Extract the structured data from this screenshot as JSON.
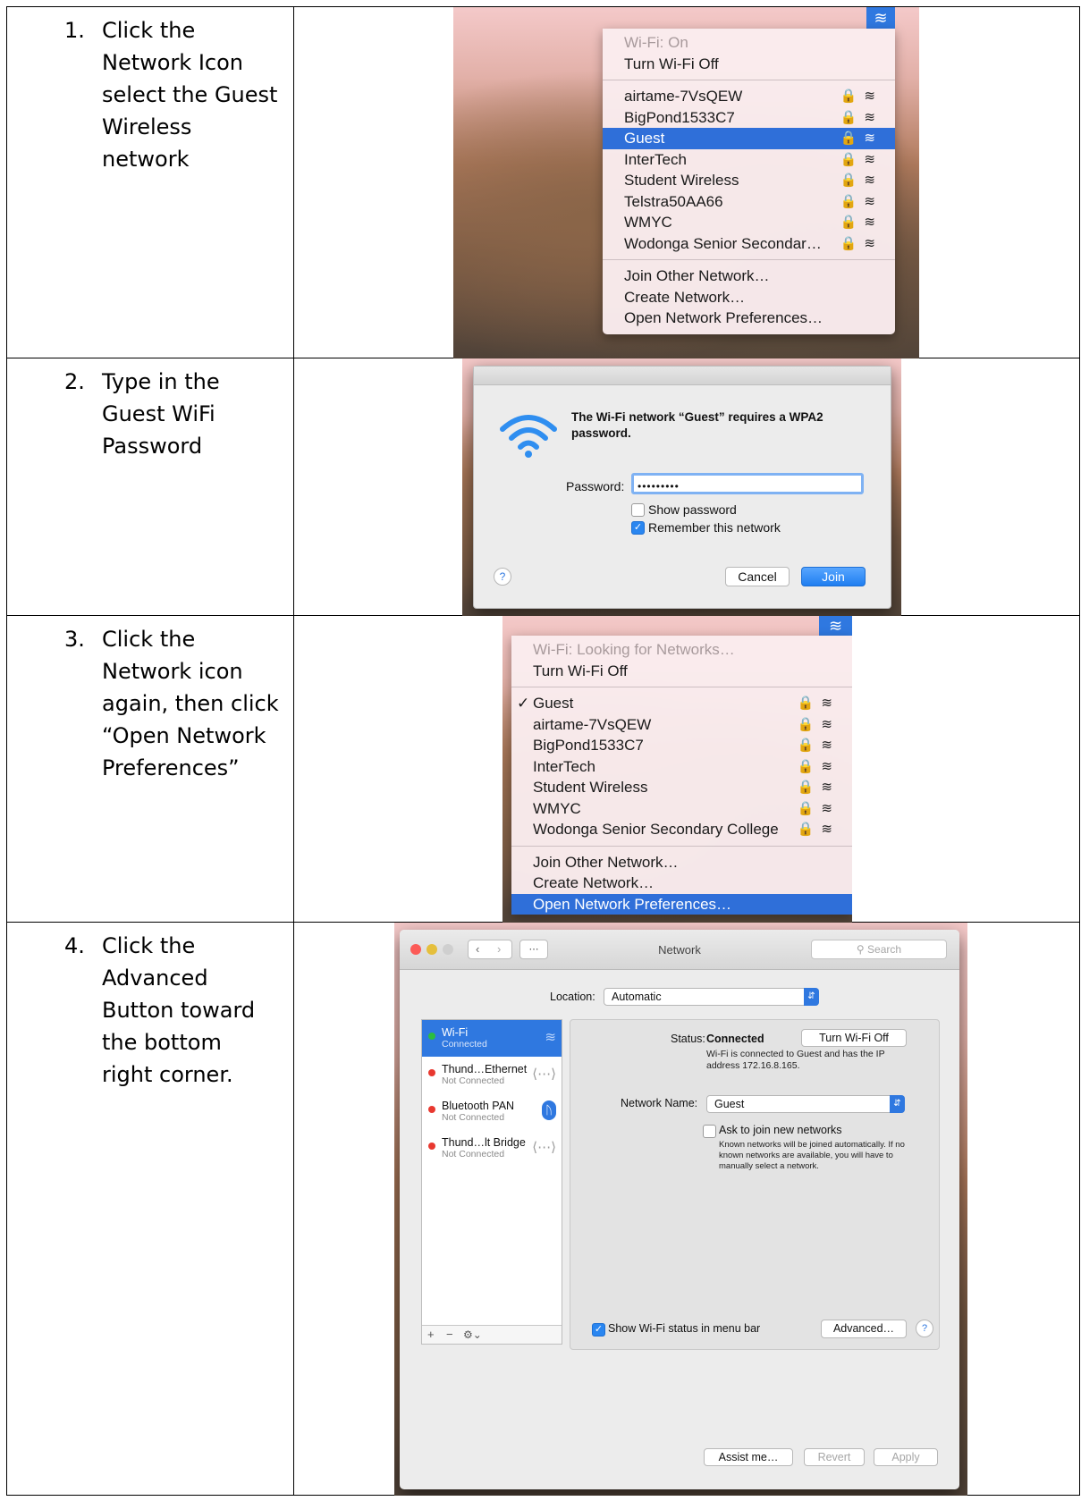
{
  "steps": [
    {
      "number": "1.",
      "lines": [
        "Click the",
        "Network Icon",
        "select the Guest",
        "Wireless",
        "network"
      ]
    },
    {
      "number": "2.",
      "lines": [
        "Type in the",
        "Guest WiFi",
        "Password"
      ]
    },
    {
      "number": "3.",
      "lines": [
        "Click the",
        "Network icon",
        "again, then click",
        "“Open Network",
        "Preferences”"
      ]
    },
    {
      "number": "4.",
      "lines": [
        "Click the",
        "Advanced",
        "Button toward",
        "the bottom",
        "right corner."
      ]
    }
  ],
  "menu1": {
    "status": "Wi-Fi: On",
    "toggle": "Turn Wi-Fi Off",
    "networks": [
      "airtame-7VsQEW",
      "BigPond1533C7",
      "Guest",
      "InterTech",
      "Student Wireless",
      "Telstra50AA66",
      "WMYC",
      "Wodonga Senior Secondar…"
    ],
    "selected_network": "Guest",
    "actions": [
      "Join Other Network…",
      "Create Network…",
      "Open Network Preferences…"
    ]
  },
  "dialog": {
    "message": "The Wi-Fi network “Guest” requires a WPA2 password.",
    "password_label": "Password:",
    "password_value": "•••••••••",
    "show_password": "Show password",
    "remember": "Remember this network",
    "help": "?",
    "cancel": "Cancel",
    "join": "Join"
  },
  "menu3": {
    "status": "Wi-Fi: Looking for Networks…",
    "toggle": "Turn Wi-Fi Off",
    "connected_mark": "✓",
    "networks": [
      "Guest",
      "airtame-7VsQEW",
      "BigPond1533C7",
      "InterTech",
      "Student Wireless",
      "WMYC",
      "Wodonga Senior Secondary College"
    ],
    "actions": [
      "Join Other Network…",
      "Create Network…",
      "Open Network Preferences…"
    ],
    "highlighted_action": "Open Network Preferences…"
  },
  "netprefs": {
    "title": "Network",
    "search_placeholder": "Search",
    "location_label": "Location:",
    "location_value": "Automatic",
    "services": [
      {
        "name": "Wi-Fi",
        "status": "Connected",
        "color": "#2bbd3f"
      },
      {
        "name": "Thund…Ethernet",
        "status": "Not Connected",
        "color": "#e8382f"
      },
      {
        "name": "Bluetooth PAN",
        "status": "Not Connected",
        "color": "#e8382f"
      },
      {
        "name": "Thund…lt Bridge",
        "status": "Not Connected",
        "color": "#e8382f"
      }
    ],
    "status_label": "Status:",
    "status_value": "Connected",
    "turn_off": "Turn Wi-Fi Off",
    "status_detail": "Wi-Fi is connected to Guest and has the IP address 172.16.8.165.",
    "network_name_label": "Network Name:",
    "network_name_value": "Guest",
    "ask_join": "Ask to join new networks",
    "ask_join_detail": "Known networks will be joined automatically. If no known networks are available, you will have to manually select a network.",
    "show_status": "Show Wi-Fi status in menu bar",
    "advanced": "Advanced…",
    "help": "?",
    "assist": "Assist me…",
    "revert": "Revert",
    "apply": "Apply",
    "add": "+",
    "remove": "−"
  }
}
